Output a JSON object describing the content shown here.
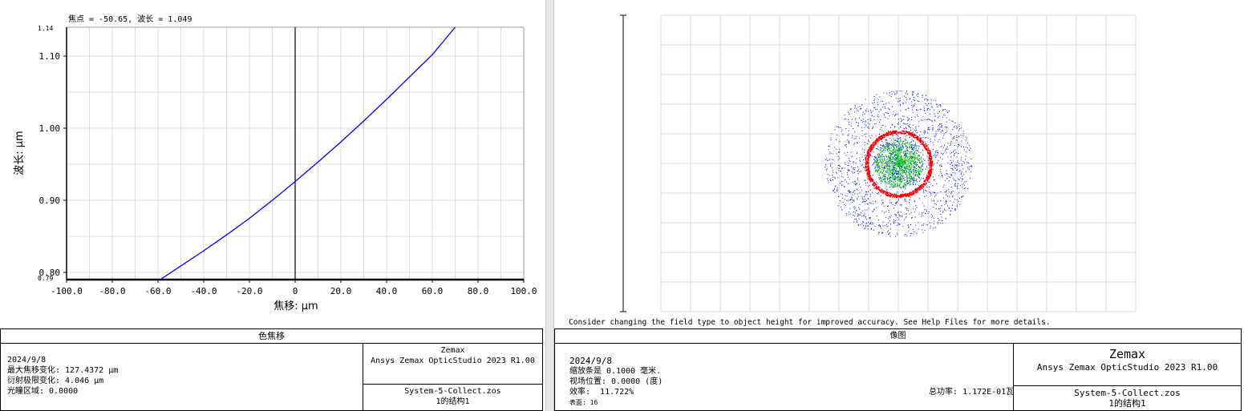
{
  "left": {
    "header": "焦点 = -50.65, 波长 = 1.049",
    "ylabel": "波长: µm",
    "xlabel": "焦移: µm",
    "y_max_label": "1.14",
    "y_min_label": "0.79",
    "footer": {
      "title": "色焦移",
      "date": "2024/9/8",
      "line1": "最大焦移变化: 127.4372 µm",
      "line2": "衍射极限变化: 4.046 µm",
      "line3": "光瞳区域: 0.0000",
      "brand": "Zemax",
      "product": "Ansys Zemax OpticStudio 2023 R1.00",
      "file": "System-5-Collect.zos",
      "config": "1的结构1"
    }
  },
  "chart_data": {
    "type": "line",
    "title": "",
    "xlabel": "焦移: µm",
    "ylabel": "波长: µm",
    "xlim": [
      -100,
      100
    ],
    "ylim": [
      0.79,
      1.14
    ],
    "xticks": [
      -100,
      -80,
      -60,
      -40,
      -20,
      0,
      20,
      40,
      60,
      80,
      100
    ],
    "xtick_labels": [
      "-100.0",
      "-80.0",
      "-60.0",
      "-40.0",
      "-20.0",
      "0",
      "20.0",
      "40.0",
      "60.0",
      "80.0",
      "100.0"
    ],
    "yticks": [
      0.8,
      0.9,
      1.0,
      1.1
    ],
    "ytick_labels": [
      "0.80",
      "0.90",
      "1.00",
      "1.10"
    ],
    "grid": true,
    "series": [
      {
        "color": "#0000ff",
        "x": [
          -59.0,
          -50,
          -40,
          -30,
          -20,
          -10,
          0,
          10,
          20,
          30,
          40,
          50,
          60,
          70
        ],
        "y": [
          0.79,
          0.809,
          0.83,
          0.852,
          0.875,
          0.9,
          0.926,
          0.953,
          0.981,
          1.01,
          1.04,
          1.071,
          1.102,
          1.14
        ]
      }
    ]
  },
  "right": {
    "note": "Consider changing the field type to object height for improved accuracy. See Help Files for more details.",
    "spot_colors": [
      "#0000ff",
      "#00cc00",
      "#ff0000"
    ],
    "footer": {
      "title": "像图",
      "date": "2024/9/8",
      "line1": "缩放条是 0.1000 毫米.",
      "line2": "视场位置: 0.0000 (度)",
      "line3": "效率:  11.722%",
      "line4": "表面: 16",
      "total": "总功率: 1.172E-01瓦",
      "brand": "Zemax",
      "product": "Ansys Zemax OpticStudio 2023 R1.00",
      "file": "System-5-Collect.zos",
      "config": "1的结构1"
    }
  }
}
